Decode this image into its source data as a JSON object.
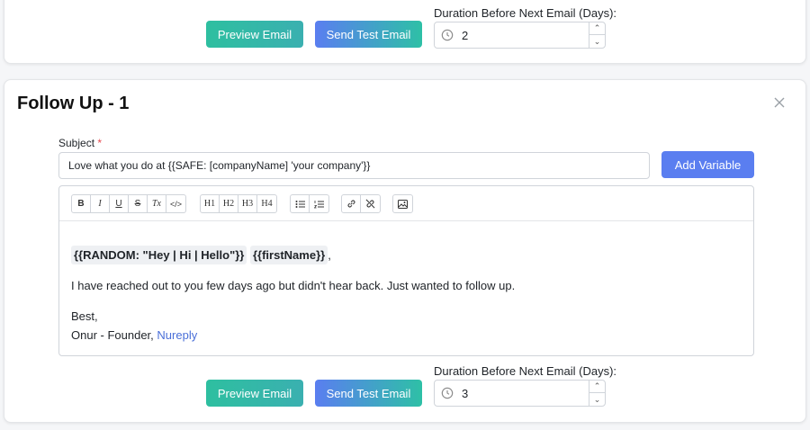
{
  "top_section": {
    "preview_label": "Preview Email",
    "send_test_label": "Send Test Email",
    "duration_label": "Duration Before Next Email (Days):",
    "duration_value": "2"
  },
  "step": {
    "title": "Follow Up - 1",
    "subject_label": "Subject",
    "subject_required": "*",
    "subject_value": "Love what you do at {{SAFE: [companyName] 'your company'}}",
    "add_variable_label": "Add Variable",
    "toolbar": {
      "group1": [
        "B",
        "I",
        "U",
        "S",
        "Tx",
        "</>"
      ],
      "group2": [
        "H1",
        "H2",
        "H3",
        "H4"
      ],
      "group3": [
        "bulleted-list-icon",
        "numbered-list-icon"
      ],
      "group4": [
        "link-icon",
        "unlink-icon"
      ],
      "group5": [
        "image-icon"
      ]
    },
    "body": {
      "var1": "{{RANDOM: \"Hey | Hi | Hello\"}}",
      "var2": "{{firstName}}",
      "comma": ",",
      "line2": "I have reached out to you few days ago but didn't hear back. Just wanted to follow up.",
      "signoff": "Best,",
      "signature": "Onur - Founder,",
      "signature_link": "Nureply"
    },
    "preview_label": "Preview Email",
    "send_test_label": "Send Test Email",
    "duration_label": "Duration Before Next Email (Days):",
    "duration_value": "3"
  }
}
